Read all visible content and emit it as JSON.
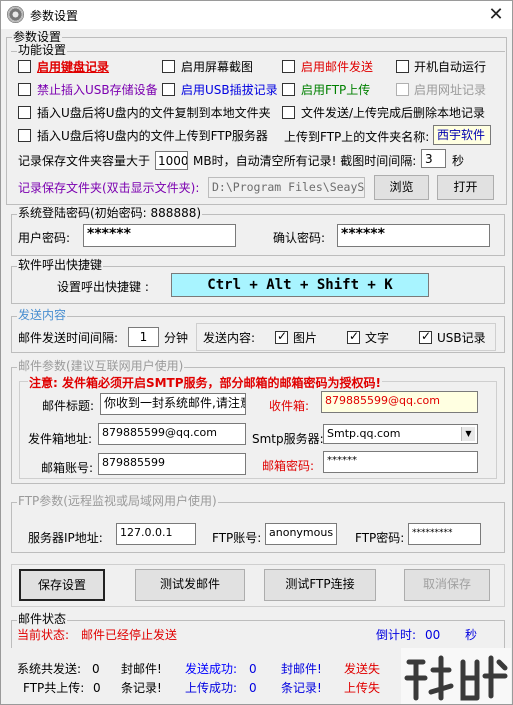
{
  "window": {
    "title": "参数设置",
    "close_symbol": "✕"
  },
  "params_group": {
    "legend": "参数设置"
  },
  "functions": {
    "legend": "功能设置",
    "items": [
      {
        "label": "启用键盘记录",
        "checked": false
      },
      {
        "label": "启用屏幕截图",
        "checked": false
      },
      {
        "label": "启用邮件发送",
        "checked": false
      },
      {
        "label": "开机自动运行",
        "checked": false
      },
      {
        "label": "禁止插入USB存储设备",
        "checked": false
      },
      {
        "label": "启用USB插拔记录",
        "checked": false
      },
      {
        "label": "启用FTP上传",
        "checked": false
      },
      {
        "label": "启用网址记录",
        "checked": false
      },
      {
        "label": "插入U盘后将U盘内的文件复制到本地文件夹",
        "checked": false
      },
      {
        "label": "文件发送/上传完成后删除本地记录",
        "checked": false
      },
      {
        "label": "插入U盘后将U盘内的文件上传到FTP服务器",
        "checked": false
      }
    ],
    "ftp_folder_label": "上传到FTP上的文件夹名称:",
    "ftp_folder_value": "西宇软件",
    "capacity_label": "记录保存文件夹容量大于",
    "capacity_value": "1000",
    "capacity_suffix": "MB时，自动清空所有记录! 截图时间间隔:",
    "interval_value": "3",
    "interval_unit": "秒",
    "folder_label": "记录保存文件夹(双击显示文件夹):",
    "folder_value": "D:\\Program Files\\SeayS",
    "browse_button": "浏览",
    "open_button": "打开"
  },
  "login": {
    "legend": "系统登陆密码(初始密码: 888888)",
    "password_label": "用户密码:",
    "password_value": "******",
    "confirm_label": "确认密码:",
    "confirm_value": "******"
  },
  "hotkey": {
    "legend": "软件呼出快捷键",
    "label": "设置呼出快捷键 :",
    "value": "Ctrl + Alt + Shift + K"
  },
  "send": {
    "legend": "发送内容",
    "interval_label": "邮件发送时间间隔:",
    "interval_value": "1",
    "interval_unit": "分钟",
    "content_label": "发送内容:",
    "options": [
      {
        "label": "图片",
        "checked": true
      },
      {
        "label": "文字",
        "checked": true
      },
      {
        "label": "USB记录",
        "checked": true
      }
    ]
  },
  "mail": {
    "legend": "邮件参数(建议互联网用户使用)",
    "notice": "注意: 发件箱必须开启SMTP服务，部分邮箱的邮箱密码为授权码!",
    "subject_label": "邮件标题:",
    "subject_value": "你收到一封系统邮件,请注意",
    "recipient_label": "收件箱:",
    "recipient_value": "879885599@qq.com",
    "sender_label": "发件箱地址:",
    "sender_value": "879885599@qq.com",
    "smtp_label": "Smtp服务器:",
    "smtp_value": "Smtp.qq.com",
    "account_label": "邮箱账号:",
    "account_value": "879885599",
    "password_label": "邮箱密码:",
    "password_value": "******"
  },
  "ftp": {
    "legend": "FTP参数(远程监视或局域网用户使用)",
    "ip_label": "服务器IP地址:",
    "ip_value": "127.0.0.1",
    "account_label": "FTP账号:",
    "account_value": "anonymous",
    "password_label": "FTP密码:",
    "password_value": "*********"
  },
  "actions": {
    "save": "保存设置",
    "test_mail": "测试发邮件",
    "test_ftp": "测试FTP连接",
    "cancel": "取消保存"
  },
  "mail_status": {
    "legend": "邮件状态",
    "current_label": "当前状态:",
    "current_value": "邮件已经停止发送",
    "countdown_label": "倒计时:",
    "countdown_value": "00",
    "countdown_unit": "秒"
  },
  "stats": {
    "row1": {
      "total_label": "系统共发送:",
      "total_value": "0",
      "total_unit": "封邮件!",
      "ok_label": "发送成功:",
      "ok_value": "0",
      "ok_unit": "封邮件!",
      "fail_label": "发送失"
    },
    "row2": {
      "total_label": "FTP共上传:",
      "total_value": "0",
      "total_unit": "条记录!",
      "ok_label": "上传成功:",
      "ok_value": "0",
      "ok_unit": "条记录!",
      "fail_label": "上传失"
    }
  },
  "colors": {
    "red": "#e00000",
    "purple": "#7b00b0",
    "green": "#008000",
    "blue": "#0000e0",
    "hotkey_bg": "#a8f4ff",
    "yellow_input": "#ffffe1"
  }
}
